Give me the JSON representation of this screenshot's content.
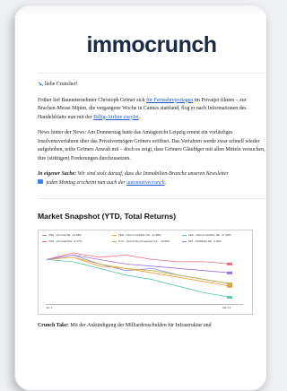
{
  "logo": {
    "text": "immocrunch"
  },
  "greeting": {
    "icon": "wave-hand-icon",
    "text": ", liebe Cruncher!"
  },
  "para1": {
    "a": "Früher lief Bauunternehmer Christoph Gröner sich ",
    "link1": "für Fernsehreportagen",
    "b": " im Privatjet filmen – zur Brachen-Messe Mipim, die vergangene Woche in Cannes stattfand, flog er nach Informationen des Handelsblatts nun mit der ",
    "link2": "Billig-Airline easyJet",
    "c": "."
  },
  "para2": {
    "text": "News hinter der News: Am Donnerstag hatte das Amtsgericht Leipzig erneut ein vorläufiges Insolvenzverfahren über das Privatvermögen Gröners eröffnet. Das Verfahren werde zwar schnell wieder aufgehoben, teilte Gröners Anwalt mit – doch es zeigt, dass Gröners Gläubiger mit allen Mitteln versuchen, ihre (strittigen) Forderungen durchzusetzen."
  },
  "note": {
    "lead": "In eigener Sache:",
    "a": " Wir sind stolz darauf, dass die Immobilien-Branche unseren Newsletter ",
    "b": " jeden Montag erscheint nun auch der ",
    "link": "automotivecrunch",
    "c": "."
  },
  "chart_section": {
    "title": "Market Snapshot (YTD, Total Returns)",
    "xlabels": [
      "Jan 2",
      "Mar 14"
    ]
  },
  "chart_data": {
    "type": "line",
    "title": "Market Snapshot (YTD, Total Returns)",
    "legend_placement": "top",
    "series": [
      {
        "name": "VNA - Vonovia SE: -11.03%",
        "color": "#8a8fe8",
        "values": [
          0,
          2,
          -2,
          -5,
          -4,
          -7,
          -9,
          -11
        ]
      },
      {
        "name": "TEG - TAG Immobilien AG: -11.89%",
        "color": "#f0a040",
        "values": [
          0,
          1,
          -3,
          -4,
          -6,
          -8,
          -10,
          -12
        ]
      },
      {
        "name": "LEG - LEG Immobilien SE: -17.26%",
        "color": "#5cc8b0",
        "values": [
          0,
          -1,
          -4,
          -7,
          -9,
          -12,
          -15,
          -17
        ]
      },
      {
        "name": "VG8 - Vonovia/TAG: -2.17%",
        "color": "#f26c7e",
        "values": [
          0,
          3,
          1,
          2,
          0,
          -1,
          -1,
          -2
        ]
      },
      {
        "name": "GYC - Grand City Properties S.A.: -10.95%",
        "color": "#c7b34a",
        "values": [
          0,
          1,
          -2,
          -4,
          -5,
          -7,
          -9,
          -11
        ]
      },
      {
        "name": "PAT - PATRIZIA SE: -6.09%",
        "color": "#a06fd6",
        "values": [
          0,
          2,
          0,
          -2,
          -3,
          -4,
          -5,
          -6
        ]
      }
    ],
    "ylim": [
      -20,
      5
    ],
    "grid": false
  },
  "caption": {
    "lead": "Crunch Take:",
    "text": " Mit der Ankündigung der Milliardenschulden für Infrastruktur und"
  }
}
